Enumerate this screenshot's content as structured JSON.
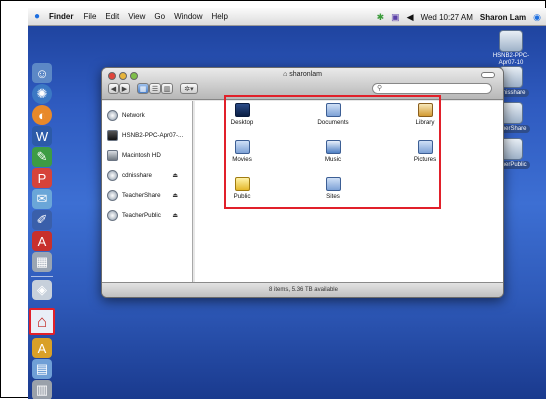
{
  "menubar": {
    "app": "Finder",
    "menus": [
      "File",
      "Edit",
      "View",
      "Go",
      "Window",
      "Help"
    ],
    "clock": "Wed 10:27 AM",
    "user": "Sharon Lam"
  },
  "desktop_icons": [
    {
      "label": "HSNB2-PPC-Apr07-10",
      "icon": "server-icon"
    },
    {
      "label": "cdnisshare",
      "icon": "network-volume-icon"
    },
    {
      "label": "acherShare",
      "icon": "network-volume-icon"
    },
    {
      "label": "acherPublic",
      "icon": "network-volume-icon"
    }
  ],
  "window": {
    "title": "sharonlam",
    "search_placeholder": "",
    "status": "8 items, 5.36 TB available",
    "sidebar": [
      {
        "label": "Network",
        "eject": false
      },
      {
        "label": "HSNB2-PPC-Apr07-...",
        "eject": false
      },
      {
        "label": "Macintosh HD",
        "eject": false
      },
      {
        "label": "cdnisshare",
        "eject": true
      },
      {
        "label": "TeacherShare",
        "eject": true
      },
      {
        "label": "TeacherPublic",
        "eject": true
      }
    ],
    "eject_glyph": "⏏",
    "folders": [
      {
        "label": "Desktop"
      },
      {
        "label": "Documents"
      },
      {
        "label": "Library"
      },
      {
        "label": "Movies"
      },
      {
        "label": "Music"
      },
      {
        "label": "Pictures"
      },
      {
        "label": "Public"
      },
      {
        "label": "Sites"
      }
    ]
  },
  "colors": {
    "highlight": "#e1202a",
    "desktop": "#2f5bc0"
  }
}
